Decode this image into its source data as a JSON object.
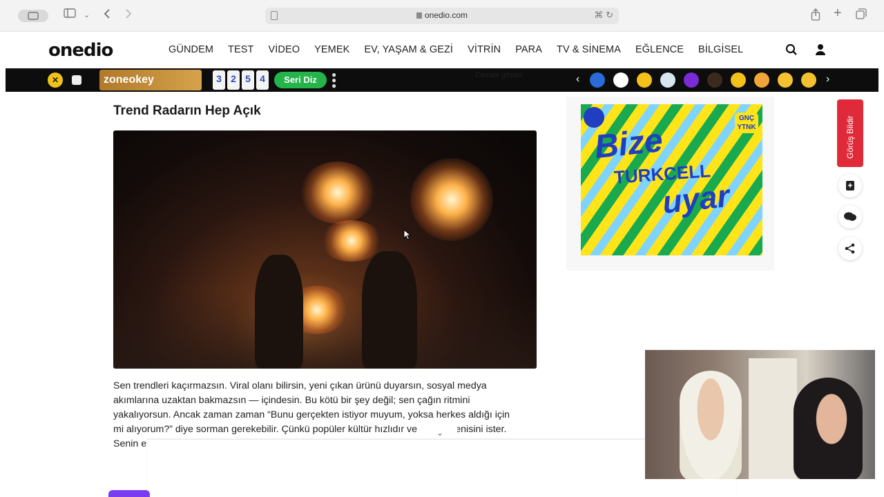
{
  "browser": {
    "url": "onedio.com",
    "icons": [
      "sidebar-icon",
      "back-icon",
      "forward-icon",
      "reader-icon",
      "translate-icon",
      "reload-icon",
      "share-icon",
      "new-tab-icon",
      "tabs-icon"
    ]
  },
  "site": {
    "logo": "onedio",
    "nav": [
      "GÜNDEM",
      "TEST",
      "VİDEO",
      "YEMEK",
      "EV, YAŞAM & GEZİ",
      "VİTRİN",
      "PARA",
      "TV & SİNEMA",
      "EĞLENCE",
      "BİLGİSEL"
    ]
  },
  "strip": {
    "zone_label": "zoneokey",
    "tiles": [
      "3",
      "2",
      "5",
      "4"
    ],
    "seri_label": "Seri Diz",
    "hidden_text": "Cevabı göster"
  },
  "article": {
    "title": "Trend Radarın Hep Açık",
    "paragraph_lines": [
      "Sen trendleri kaçırmazsın. Viral olanı bilirsin, yeni çıkan ürünü duyarsın, sosyal medya",
      "akımlarına uzaktan bakmazsın — içindesin. Bu kötü bir şey değil; sen çağın ritmini",
      "yakalıyorsun. Ancak zaman zaman “Bunu gerçekten istiyor muyum, yoksa herkes aldığı için",
      "mi alıyorum?” diye sorman gerekebilir. Çünkü popüler kültür hızlıdır ve",
      "Senin e"
    ],
    "paragraph_line4_tail": "ki yenisini ister."
  },
  "ad": {
    "line1": "Bize",
    "line2": "TURKCELL",
    "line3": "uyar",
    "badge": "GNÇ YTNK"
  },
  "sidebar": {
    "feedback_label": "Görüş Bildir"
  },
  "colors": {
    "feedback_red": "#e02a3a",
    "seri_green": "#25b34b",
    "strip_black": "#0d0d0d"
  }
}
